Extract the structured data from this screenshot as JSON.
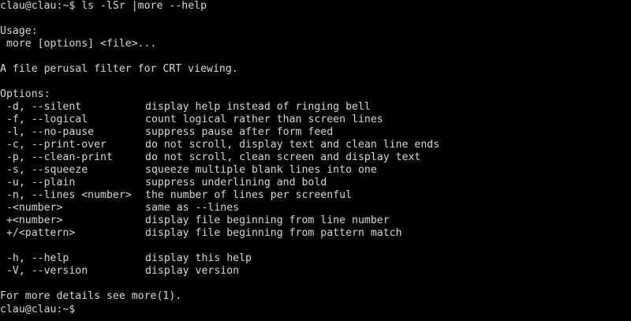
{
  "terminal": {
    "prompt": "clau@clau:~$",
    "command": " ls -lSr |more --help",
    "usage_header": "Usage:",
    "usage_line": " more [options] <file>...",
    "description": "A file perusal filter for CRT viewing.",
    "options_header": "Options:",
    "options": [
      {
        "flag": " -d, --silent",
        "desc": "display help instead of ringing bell"
      },
      {
        "flag": " -f, --logical",
        "desc": "count logical rather than screen lines"
      },
      {
        "flag": " -l, --no-pause",
        "desc": "suppress pause after form feed"
      },
      {
        "flag": " -c, --print-over",
        "desc": "do not scroll, display text and clean line ends"
      },
      {
        "flag": " -p, --clean-print",
        "desc": "do not scroll, clean screen and display text"
      },
      {
        "flag": " -s, --squeeze",
        "desc": "squeeze multiple blank lines into one"
      },
      {
        "flag": " -u, --plain",
        "desc": "suppress underlining and bold"
      },
      {
        "flag": " -n, --lines <number>",
        "desc": "the number of lines per screenful"
      },
      {
        "flag": " -<number>",
        "desc": "same as --lines"
      },
      {
        "flag": " +<number>",
        "desc": "display file beginning from line number"
      },
      {
        "flag": " +/<pattern>",
        "desc": "display file beginning from pattern match"
      }
    ],
    "help_options": [
      {
        "flag": " -h, --help",
        "desc": "display this help"
      },
      {
        "flag": " -V, --version",
        "desc": "display version"
      }
    ],
    "footer": "For more details see more(1).",
    "final_prompt": "clau@clau:~$"
  },
  "colors": {
    "background": "#000000",
    "text": "#d8d8d8"
  }
}
